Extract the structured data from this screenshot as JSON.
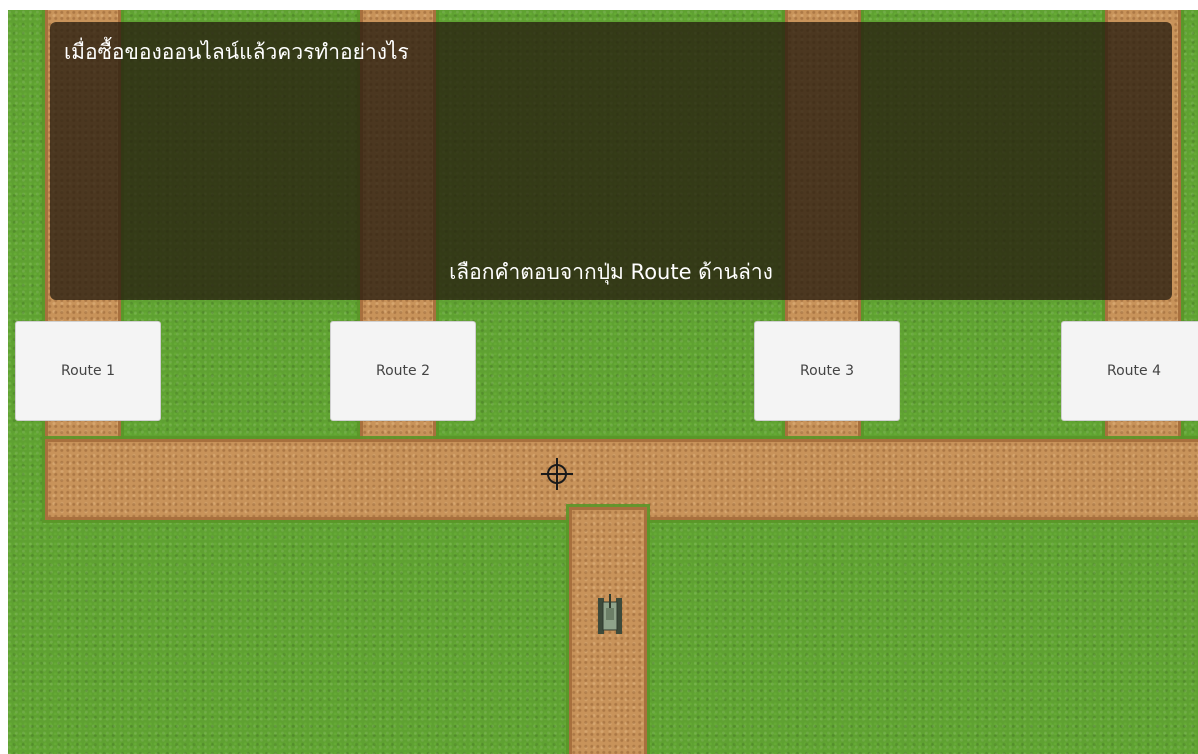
{
  "question": "เมื่อซื้อของออนไลน์แล้วควรทำอย่างไร",
  "hint": "เลือกคำตอบจากปุ่ม Route ด้านล่าง",
  "routes": [
    {
      "label": "Route 1"
    },
    {
      "label": "Route 2"
    },
    {
      "label": "Route 3"
    },
    {
      "label": "Route 4"
    }
  ],
  "colors": {
    "grass": "#5fa132",
    "road": "#c8935a",
    "panel": "rgba(40,30,15,0.78)",
    "button": "#f4f4f4"
  },
  "icons": {
    "crosshair": "crosshair-icon",
    "tank": "tank-icon"
  }
}
